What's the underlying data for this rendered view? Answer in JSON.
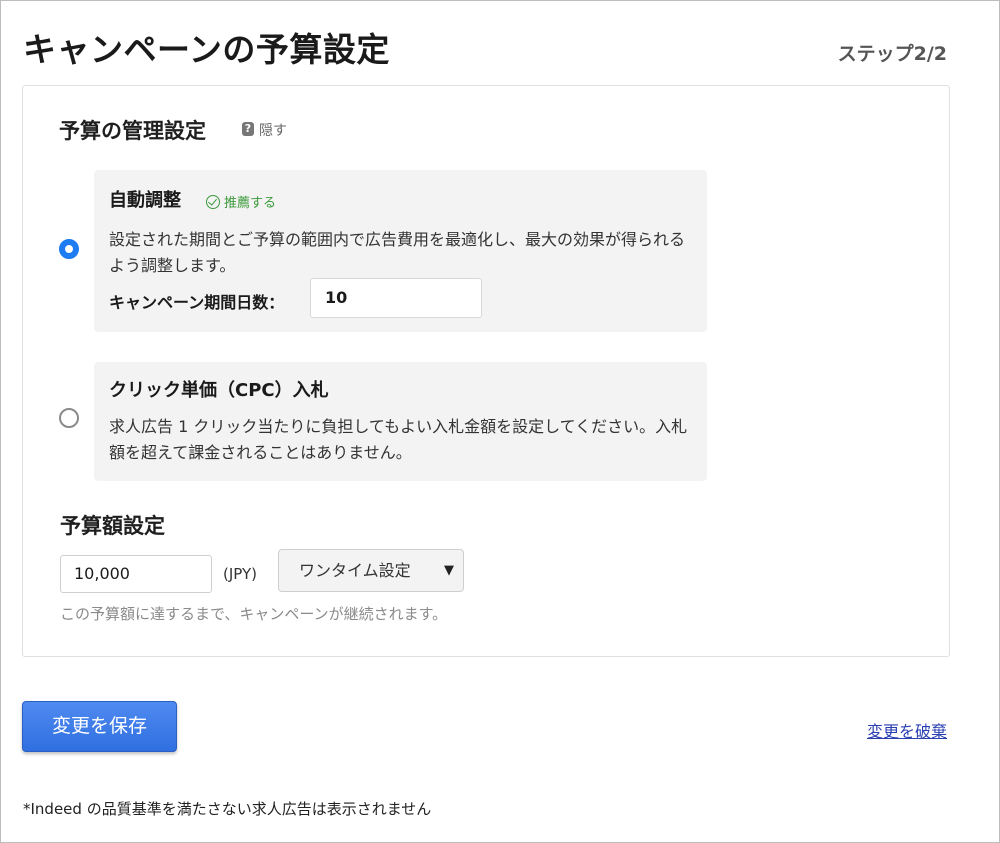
{
  "header": {
    "title": "キャンペーンの予算設定",
    "step": "ステップ2/2"
  },
  "budget_management": {
    "heading": "予算の管理設定",
    "help_icon": "?",
    "hide_label": "隠す",
    "options": [
      {
        "title": "自動調整",
        "badge": "推薦する",
        "description": "設定された期間とご予算の範囲内で広告費用を最適化し、最大の効果が得られるよう調整します。",
        "selected": true,
        "days_label": "キャンペーン期間日数：",
        "days_value": "10"
      },
      {
        "title": "クリック単価（CPC）入札",
        "description": "求人広告 1 クリック当たりに負担してもよい入札金額を設定してください。入札額を超えて課金されることはありません。",
        "selected": false
      }
    ]
  },
  "budget_amount": {
    "heading": "予算額設定",
    "value": "10,000",
    "currency": "(JPY)",
    "type_selected": "ワンタイム設定",
    "help_text": "この予算額に達するまで、キャンペーンが継続されます。"
  },
  "actions": {
    "save_label": "変更を保存",
    "discard_label": "変更を破棄"
  },
  "footnote": "*Indeed の品質基準を満たさない求人広告は表示されません",
  "colors": {
    "accent": "#1d7cf2",
    "recommend_green": "#3a9a3a",
    "button_blue": "#3a78e8",
    "link_blue": "#2a3fb0"
  }
}
